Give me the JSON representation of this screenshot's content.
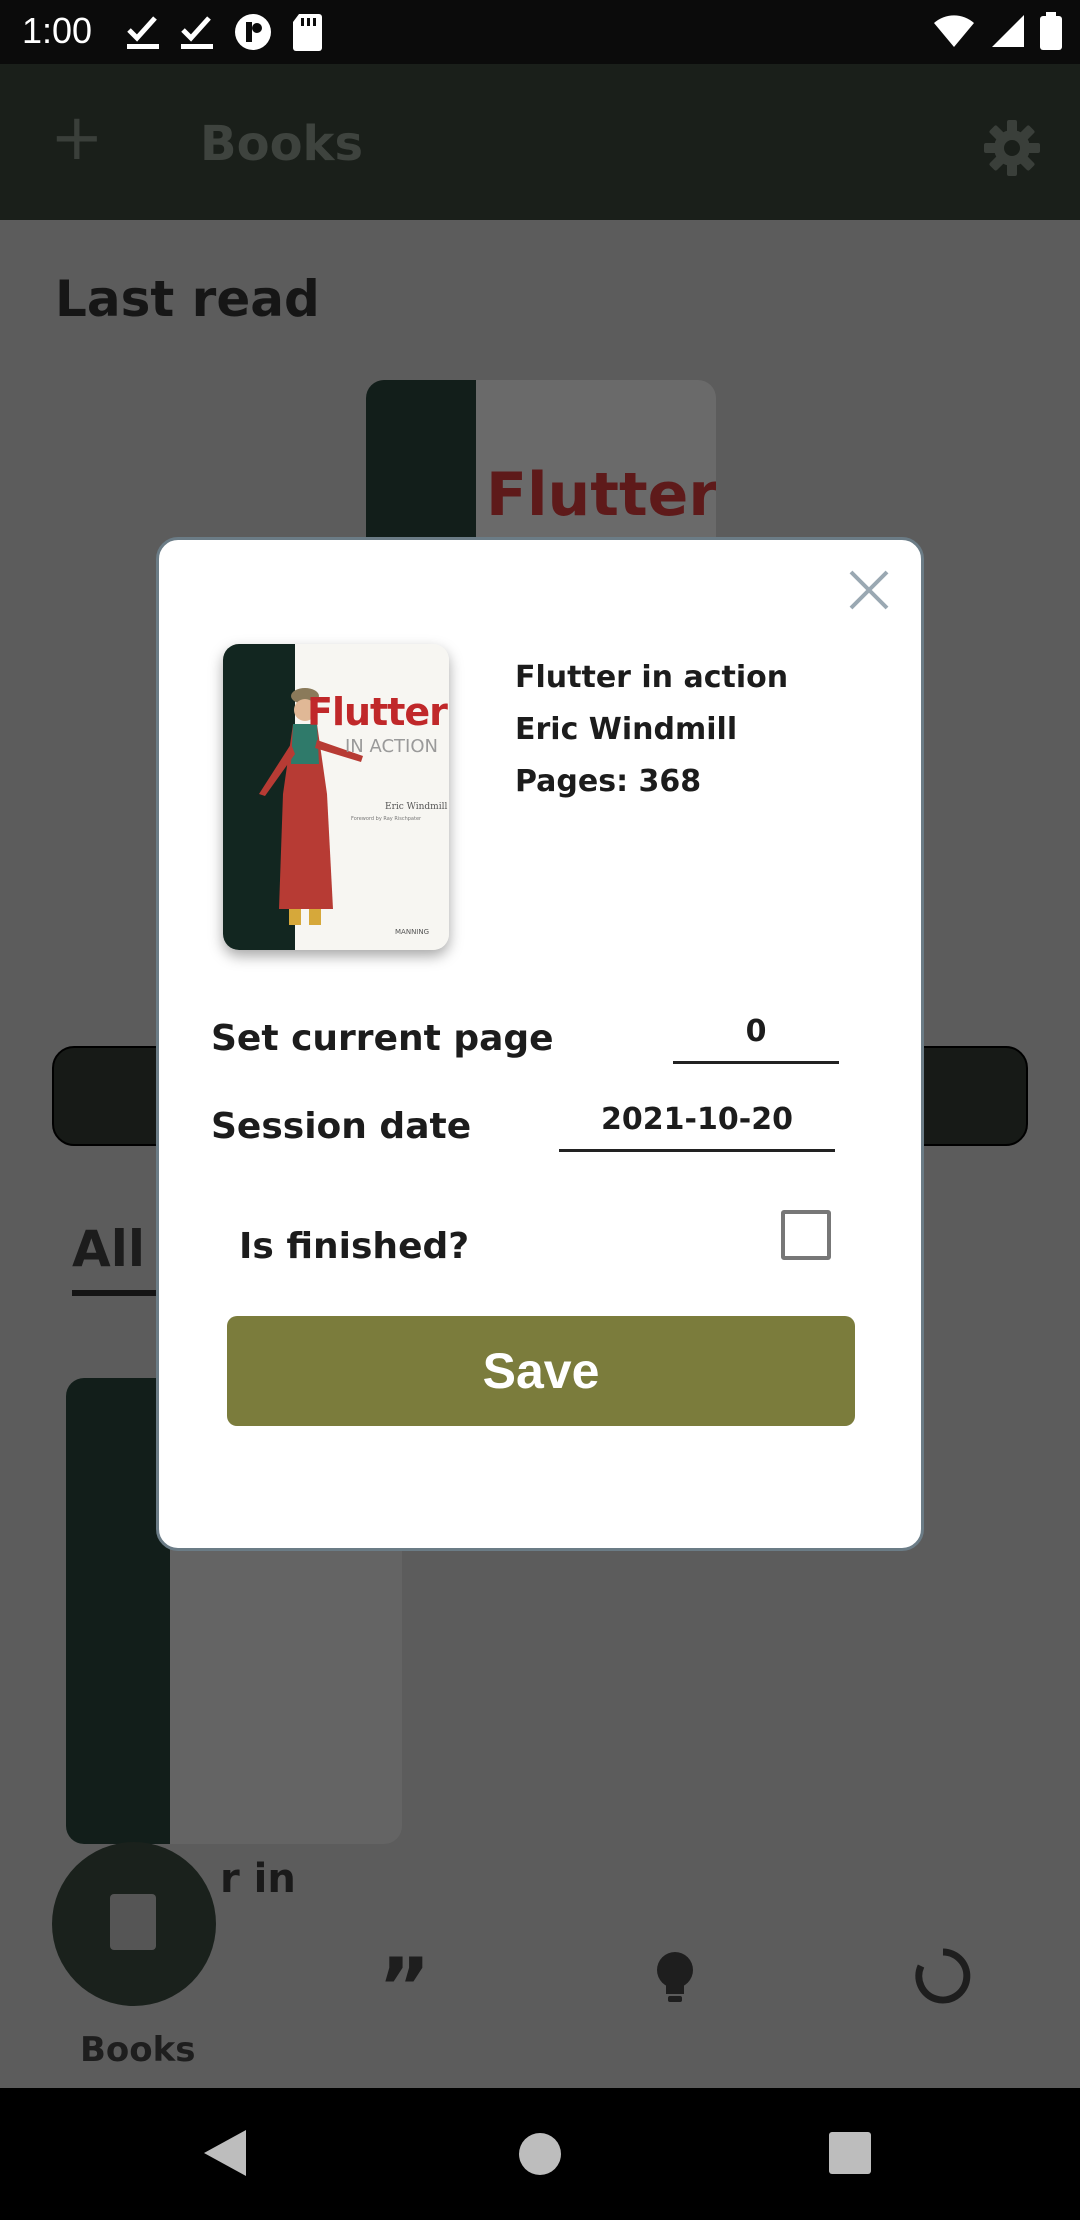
{
  "status_bar": {
    "time": "1:00"
  },
  "app_bar": {
    "title": "Books",
    "add_symbol": "+"
  },
  "background": {
    "section_last_read": "Last read",
    "section_all": "All",
    "book_label_partial": "r in",
    "cover_text": "Flutter"
  },
  "bottom_nav": {
    "books_label": "Books",
    "quote_symbol": "”"
  },
  "dialog": {
    "book": {
      "title": "Flutter in action",
      "author": "Eric Windmill",
      "pages": "Pages: 368",
      "cover_title": "Flutter",
      "cover_subtitle": "IN ACTION",
      "cover_author": "Eric Windmill",
      "cover_foreword": "Foreword by Ray Rischpater",
      "cover_publisher": "MANNING"
    },
    "current_page_label": "Set current page",
    "current_page_value": "0",
    "session_date_label": "Session date",
    "session_date_value": "2021-10-20",
    "is_finished_label": "Is finished?",
    "save_label": "Save"
  },
  "colors": {
    "save_button": "#7b7c3c",
    "dialog_border": "#6b7c86",
    "cover_accent": "#c0282a"
  }
}
